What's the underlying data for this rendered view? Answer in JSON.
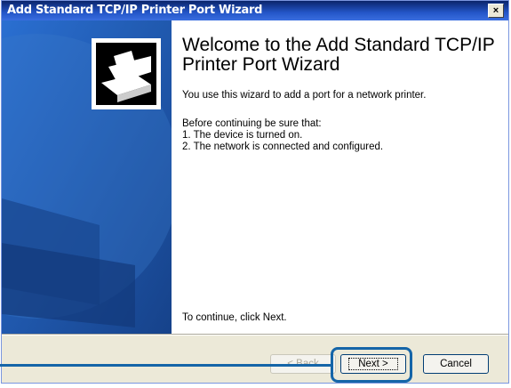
{
  "window": {
    "title": "Add Standard TCP/IP Printer Port Wizard",
    "close_label": "×"
  },
  "content": {
    "heading": "Welcome to the Add Standard TCP/IP Printer Port Wizard",
    "intro": "You use this wizard to add a port for a network printer.",
    "before_label": "Before continuing be sure that:",
    "item_1": "1.  The device is turned on.",
    "item_2": "2.  The network is connected and configured.",
    "footer": "To continue, click Next."
  },
  "buttons": {
    "back": "< Back",
    "next": "Next >",
    "cancel": "Cancel"
  },
  "icons": {
    "side": "printer-wizard-icon",
    "close": "close-icon"
  },
  "colors": {
    "side_panel": "#1d53a3",
    "titlebar": "#0a246a",
    "highlight": "#1565a8"
  }
}
